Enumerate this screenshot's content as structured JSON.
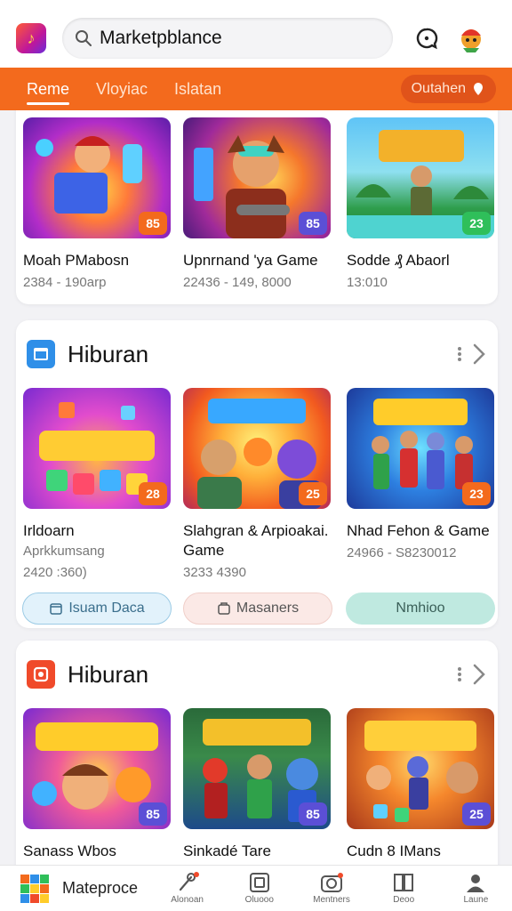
{
  "header": {
    "search_value": "Marketpblance",
    "search_placeholder": "Marketpblance"
  },
  "tabs": [
    {
      "label": "Reme",
      "active": true
    },
    {
      "label": "Vloyiac",
      "active": false
    },
    {
      "label": "Islatan",
      "active": false
    }
  ],
  "tab_pill": {
    "label": "Outahen"
  },
  "section1": {
    "items": [
      {
        "name": "Moah PMabosn",
        "meta": "2384 - 190arp",
        "badge": "85",
        "badge_color": "#f36a1d"
      },
      {
        "name": "Upnrnand 'ya Game",
        "meta": "22436 - 149, 8000",
        "badge": "85",
        "badge_color": "#5b4fd6"
      },
      {
        "name": "Sodde ₰ Abaorl",
        "meta": "13:010",
        "badge": "23",
        "badge_color": "#2fbf5a"
      }
    ]
  },
  "section2": {
    "title": "Hiburan",
    "icon_color": "#2f8fe8",
    "items": [
      {
        "name": "Irldoarn",
        "sub": "Aprkkumsang",
        "meta": "2420 :360)",
        "badge": "28",
        "badge_color": "#f36a1d"
      },
      {
        "name": "Slahgran & Arpioakai. Game",
        "sub": "",
        "meta": "3233 4390",
        "badge": "25",
        "badge_color": "#f36a1d"
      },
      {
        "name": "Nhad Fehon & Game",
        "sub": "",
        "meta": "24966 - S8230012",
        "badge": "23",
        "badge_color": "#f36a1d"
      }
    ],
    "chips": [
      {
        "label": "Isuam Daca"
      },
      {
        "label": "Masaners"
      },
      {
        "label": "Nmhioo"
      }
    ]
  },
  "section3": {
    "title": "Hiburan",
    "icon_color": "#f04a2a",
    "items": [
      {
        "name": "Sanass Wbos",
        "badge": "85",
        "badge_color": "#5b4fd6"
      },
      {
        "name": "Sinkadé Tare",
        "badge": "85",
        "badge_color": "#5b4fd6"
      },
      {
        "name": "Cudn 8 IMans",
        "badge": "25",
        "badge_color": "#5b4fd6"
      }
    ]
  },
  "bottom_nav": {
    "brand_label": "Mateproce",
    "items": [
      {
        "label": "Alonoan"
      },
      {
        "label": "Oluooo"
      },
      {
        "label": "Mentners"
      },
      {
        "label": "Deoo"
      },
      {
        "label": "Laune"
      }
    ]
  }
}
